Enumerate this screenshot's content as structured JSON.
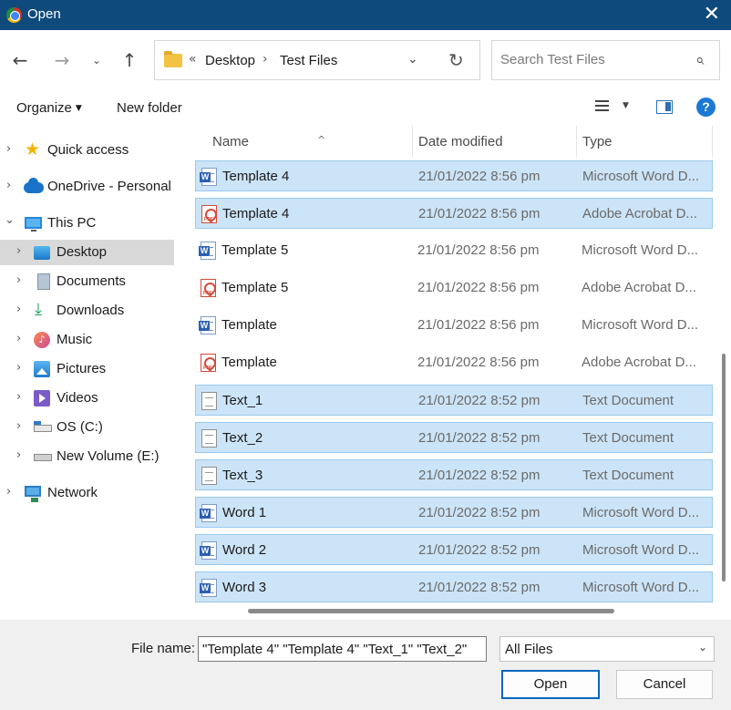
{
  "window": {
    "title": "Open",
    "close_glyph": "✕"
  },
  "nav_buttons": {
    "back": "←",
    "forward": "→",
    "history": "⌄",
    "up": "↑"
  },
  "address": {
    "overflow": "«",
    "crumbs": [
      "Desktop",
      "Test Files"
    ],
    "separator": "›",
    "dropdown": "⌄",
    "refresh": "↻"
  },
  "search": {
    "placeholder": "Search Test Files",
    "value": ""
  },
  "toolbar": {
    "organize_label": "Organize",
    "organize_caret": "▼",
    "new_folder_label": "New folder",
    "view_caret": "▼",
    "help_glyph": "?"
  },
  "sidebar": {
    "items": [
      {
        "label": "Quick access",
        "icon": "star-icon",
        "icon_glyph": "★"
      },
      {
        "label": "OneDrive - Personal",
        "icon": "cloud-icon"
      },
      {
        "label": "This PC",
        "icon": "pc-icon"
      },
      {
        "label": "Desktop",
        "icon": "desktop-icon",
        "selected": true
      },
      {
        "label": "Documents",
        "icon": "documents-icon"
      },
      {
        "label": "Downloads",
        "icon": "downloads-icon",
        "icon_glyph": "⤓"
      },
      {
        "label": "Music",
        "icon": "music-icon",
        "icon_glyph": "♪"
      },
      {
        "label": "Pictures",
        "icon": "pictures-icon"
      },
      {
        "label": "Videos",
        "icon": "videos-icon"
      },
      {
        "label": "OS (C:)",
        "icon": "drive-icon"
      },
      {
        "label": "New Volume (E:)",
        "icon": "drive-icon"
      },
      {
        "label": "Network",
        "icon": "network-icon"
      }
    ],
    "chevron_collapsed": "›",
    "chevron_expanded": "⌄"
  },
  "columns": {
    "name": "Name",
    "date": "Date modified",
    "type": "Type",
    "sort_glyph": "^"
  },
  "files": [
    {
      "name": "Template 4",
      "date": "21/01/2022 8:56 pm",
      "type": "Microsoft Word D...",
      "kind": "word",
      "selected": true
    },
    {
      "name": "Template 4",
      "date": "21/01/2022 8:56 pm",
      "type": "Adobe Acrobat D...",
      "kind": "pdf",
      "selected": true
    },
    {
      "name": "Template 5",
      "date": "21/01/2022 8:56 pm",
      "type": "Microsoft Word D...",
      "kind": "word",
      "selected": false
    },
    {
      "name": "Template 5",
      "date": "21/01/2022 8:56 pm",
      "type": "Adobe Acrobat D...",
      "kind": "pdf",
      "selected": false
    },
    {
      "name": "Template",
      "date": "21/01/2022 8:56 pm",
      "type": "Microsoft Word D...",
      "kind": "word",
      "selected": false
    },
    {
      "name": "Template",
      "date": "21/01/2022 8:56 pm",
      "type": "Adobe Acrobat D...",
      "kind": "pdf",
      "selected": false
    },
    {
      "name": "Text_1",
      "date": "21/01/2022 8:52 pm",
      "type": "Text Document",
      "kind": "text",
      "selected": true
    },
    {
      "name": "Text_2",
      "date": "21/01/2022 8:52 pm",
      "type": "Text Document",
      "kind": "text",
      "selected": true
    },
    {
      "name": "Text_3",
      "date": "21/01/2022 8:52 pm",
      "type": "Text Document",
      "kind": "text",
      "selected": true
    },
    {
      "name": "Word 1",
      "date": "21/01/2022 8:52 pm",
      "type": "Microsoft Word D...",
      "kind": "word",
      "selected": true
    },
    {
      "name": "Word 2",
      "date": "21/01/2022 8:52 pm",
      "type": "Microsoft Word D...",
      "kind": "word",
      "selected": true
    },
    {
      "name": "Word 3",
      "date": "21/01/2022 8:52 pm",
      "type": "Microsoft Word D...",
      "kind": "word",
      "selected": true
    }
  ],
  "footer": {
    "file_name_label": "File name:",
    "file_name_value": "\"Template 4\" \"Template 4\" \"Text_1\" \"Text_2\"",
    "filter_value": "All Files",
    "filter_caret": "⌄",
    "open_label": "Open",
    "cancel_label": "Cancel"
  },
  "colors": {
    "titlebar": "#0f4a7c",
    "selection": "#cce4f7",
    "selection_border": "#99c9ef",
    "accent": "#0067c0"
  }
}
